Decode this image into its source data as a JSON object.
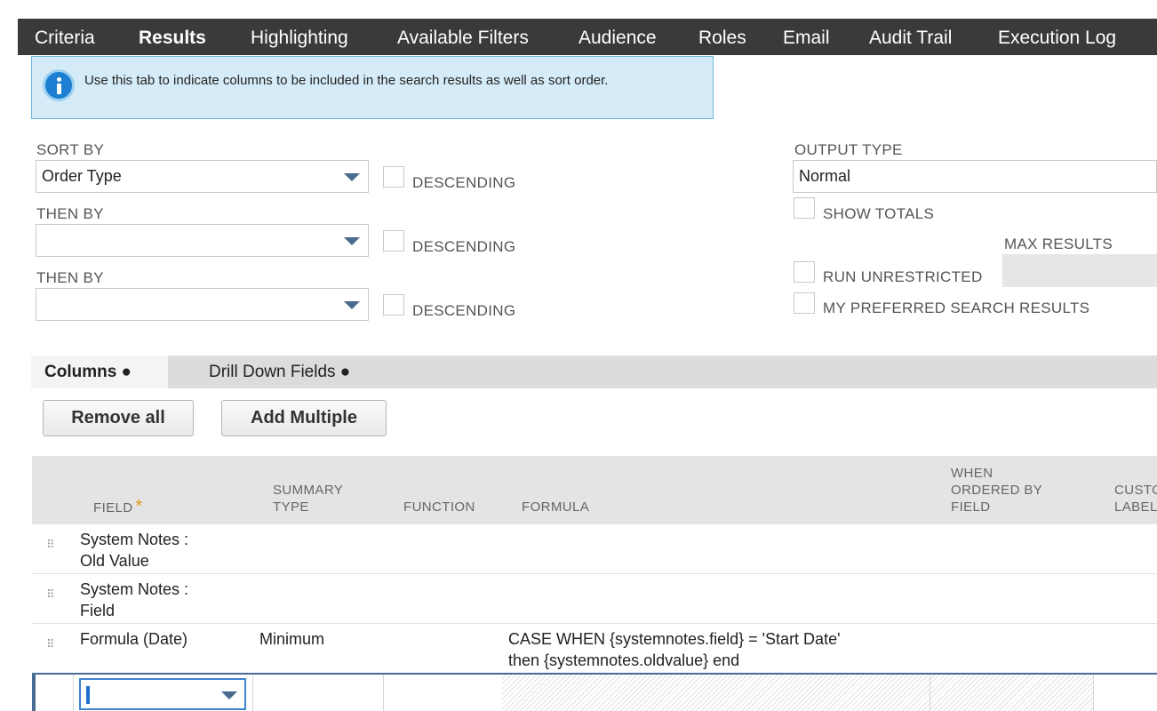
{
  "tabs": [
    {
      "label": "Criteria"
    },
    {
      "label": "Results"
    },
    {
      "label": "Highlighting"
    },
    {
      "label": "Available Filters"
    },
    {
      "label": "Audience"
    },
    {
      "label": "Roles"
    },
    {
      "label": "Email"
    },
    {
      "label": "Audit Trail"
    },
    {
      "label": "Execution Log"
    }
  ],
  "active_tab": "Results",
  "info_banner": {
    "text": "Use this tab to indicate columns to be included in the search results as well as sort order."
  },
  "sort": {
    "sort_by_label": "SORT BY",
    "sort_by_value": "Order Type",
    "then_by_label_1": "THEN BY",
    "then_by_value_1": "",
    "then_by_label_2": "THEN BY",
    "then_by_value_2": "",
    "descending_label": "DESCENDING"
  },
  "output": {
    "output_type_label": "OUTPUT TYPE",
    "output_type_value": "Normal",
    "show_totals_label": "SHOW TOTALS",
    "max_results_label": "MAX RESULTS",
    "run_unrestricted_label": "RUN UNRESTRICTED",
    "my_preferred_label": "MY PREFERRED SEARCH RESULTS"
  },
  "subtabs": [
    {
      "label": "Columns ●"
    },
    {
      "label": "Drill Down Fields ●"
    }
  ],
  "buttons": {
    "remove_all": "Remove all",
    "add_multiple": "Add Multiple"
  },
  "grid": {
    "headers": {
      "field": "FIELD",
      "required_mark": "*",
      "summary_type_1": "SUMMARY",
      "summary_type_2": "TYPE",
      "function": "FUNCTION",
      "formula": "FORMULA",
      "when_ordered_1": "WHEN",
      "when_ordered_2": "ORDERED BY",
      "when_ordered_3": "FIELD",
      "custom_label_1": "CUSTO",
      "custom_label_2": "LABEL"
    },
    "rows": [
      {
        "field_1": "System Notes :",
        "field_2": "Old Value",
        "summary_type": "",
        "function": "",
        "formula_1": "",
        "formula_2": ""
      },
      {
        "field_1": "System Notes :",
        "field_2": "Field",
        "summary_type": "",
        "function": "",
        "formula_1": "",
        "formula_2": ""
      },
      {
        "field_1": "Formula (Date)",
        "field_2": "",
        "summary_type": "Minimum",
        "function": "",
        "formula_1": "CASE WHEN {systemnotes.field} = 'Start Date'",
        "formula_2": "then {systemnotes.oldvalue} end"
      }
    ]
  },
  "icons": {
    "info": "info-icon",
    "dropdown": "chevron-down-icon",
    "drag": "drag-handle-icon"
  },
  "colors": {
    "topbar": "#3a3a3a",
    "banner": "#d5ecf8",
    "accent": "#1d7fd1",
    "required": "#e09a1a"
  }
}
